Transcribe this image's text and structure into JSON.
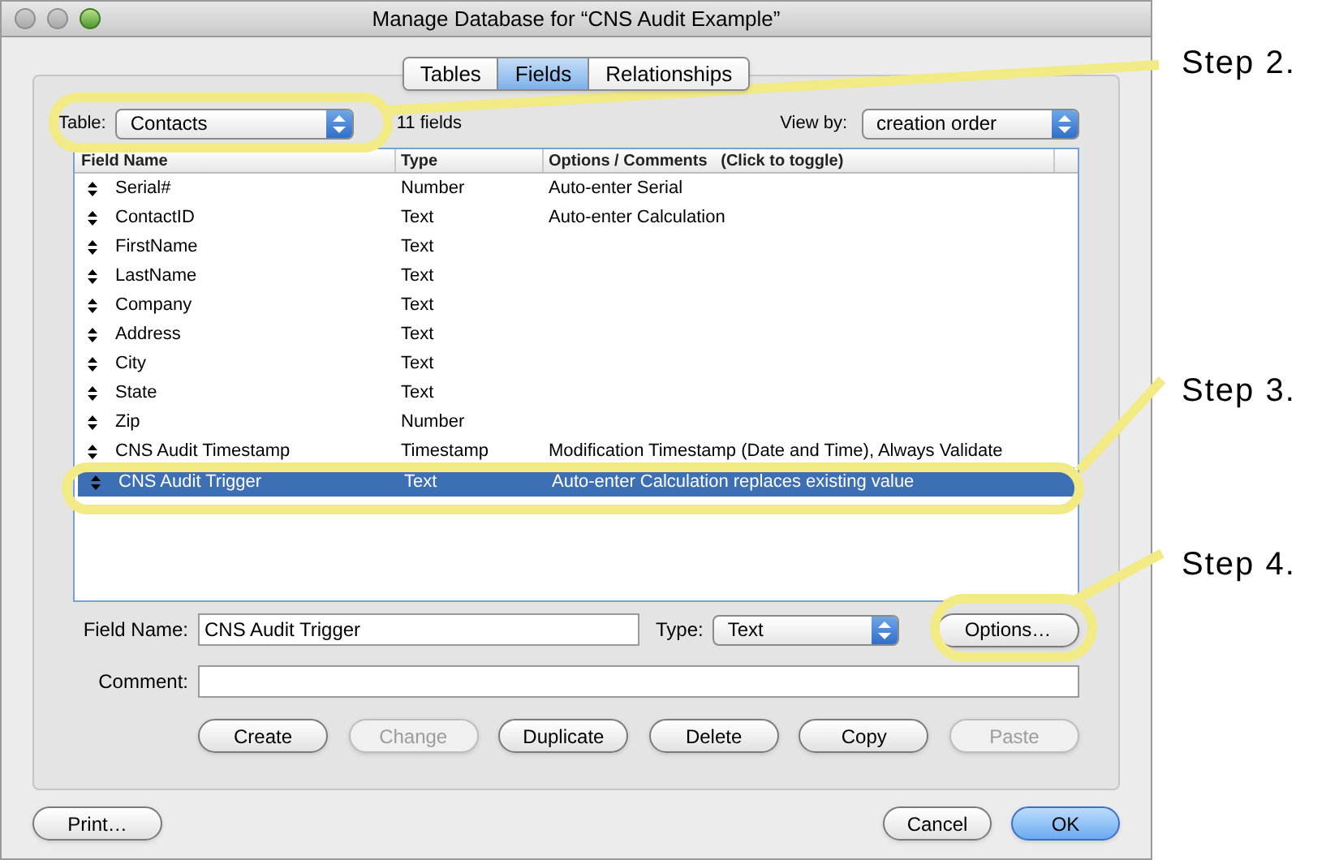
{
  "window": {
    "title": "Manage Database for “CNS Audit Example”"
  },
  "tabs": [
    {
      "label": "Tables",
      "selected": false
    },
    {
      "label": "Fields",
      "selected": true
    },
    {
      "label": "Relationships",
      "selected": false
    }
  ],
  "table_picker": {
    "label": "Table:",
    "value": "Contacts"
  },
  "field_count": "11 fields",
  "view_by": {
    "label": "View by:",
    "value": "creation order"
  },
  "columns": [
    "Field Name",
    "Type",
    "Options / Comments   (Click to toggle)"
  ],
  "rows": [
    {
      "name": "Serial#",
      "type": "Number",
      "options": "Auto-enter Serial",
      "selected": false
    },
    {
      "name": "ContactID",
      "type": "Text",
      "options": "Auto-enter Calculation",
      "selected": false
    },
    {
      "name": "FirstName",
      "type": "Text",
      "selected": false
    },
    {
      "name": "LastName",
      "type": "Text",
      "selected": false
    },
    {
      "name": "Company",
      "type": "Text",
      "selected": false
    },
    {
      "name": "Address",
      "type": "Text",
      "selected": false
    },
    {
      "name": "City",
      "type": "Text",
      "selected": false
    },
    {
      "name": "State",
      "type": "Text",
      "selected": false
    },
    {
      "name": "Zip",
      "type": "Number",
      "selected": false
    },
    {
      "name": "CNS Audit Timestamp",
      "type": "Timestamp",
      "options": "Modification Timestamp (Date and Time), Always Validate",
      "selected": false
    },
    {
      "name": "CNS Audit Trigger",
      "type": "Text",
      "options": "Auto-enter Calculation replaces existing value",
      "selected": true
    }
  ],
  "field_name": {
    "label": "Field Name:",
    "value": "CNS Audit Trigger"
  },
  "type": {
    "label": "Type:",
    "value": "Text"
  },
  "options_button": "Options…",
  "comment": {
    "label": "Comment:"
  },
  "actions": [
    {
      "label": "Create",
      "disabled": false
    },
    {
      "label": "Change",
      "disabled": true
    },
    {
      "label": "Duplicate",
      "disabled": false
    },
    {
      "label": "Delete",
      "disabled": false
    },
    {
      "label": "Copy",
      "disabled": false
    },
    {
      "label": "Paste",
      "disabled": true
    }
  ],
  "print_button": "Print…",
  "cancel_button": "Cancel",
  "ok_button": "OK",
  "annotations": [
    {
      "label": "Step 2."
    },
    {
      "label": "Step 3."
    },
    {
      "label": "Step 4."
    }
  ]
}
